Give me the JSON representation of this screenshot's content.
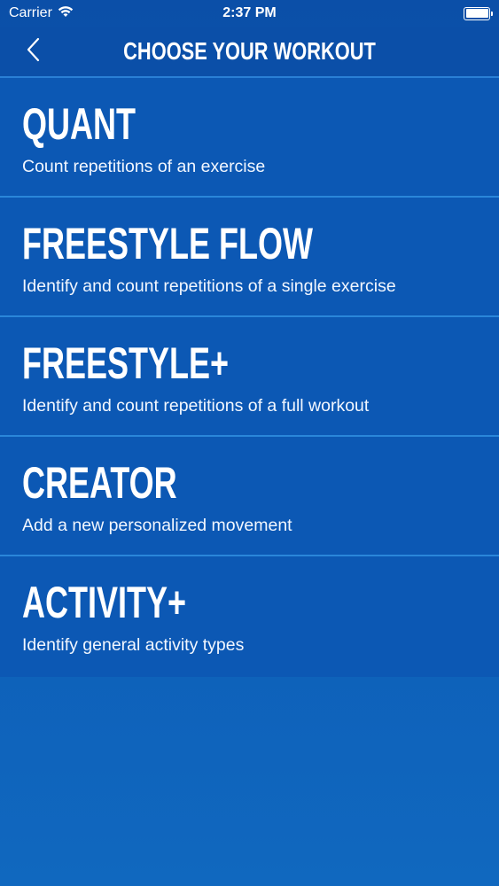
{
  "status_bar": {
    "carrier": "Carrier",
    "time": "2:37 PM",
    "battery_level": 1.0,
    "wifi_icon": "wifi-icon",
    "battery_icon": "battery-icon"
  },
  "nav": {
    "title": "CHOOSE YOUR WORKOUT",
    "back_icon": "chevron-left-icon"
  },
  "workouts": [
    {
      "title": "QUANT",
      "description": "Count repetitions of an exercise"
    },
    {
      "title": "FREESTYLE FLOW",
      "description": "Identify and count repetitions of a single exercise"
    },
    {
      "title": "FREESTYLE+",
      "description": "Identify and count repetitions of a full workout"
    },
    {
      "title": "CREATOR",
      "description": "Add a new personalized movement"
    },
    {
      "title": "ACTIVITY+",
      "description": "Identify general activity types"
    }
  ],
  "colors": {
    "background": "#0d5cb6",
    "nav_background": "#0b4fa8",
    "item_background": "#0c58b4",
    "divider": "#2a86d9",
    "text": "#ffffff"
  }
}
